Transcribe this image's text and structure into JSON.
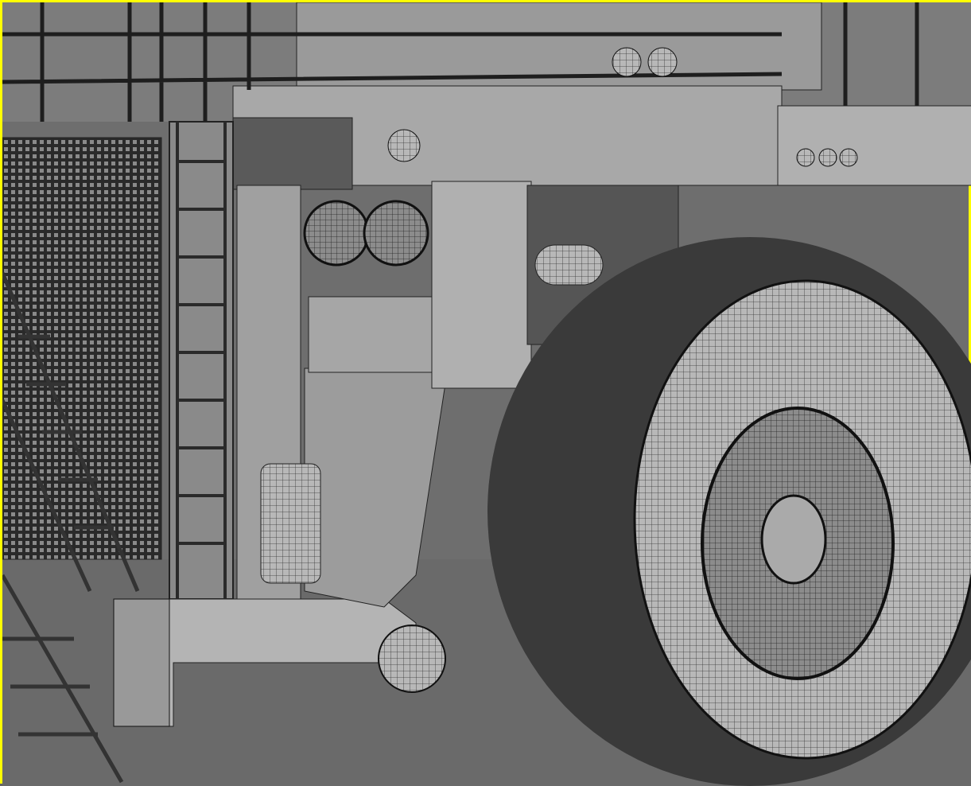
{
  "viewport": {
    "active_border_color": "#ffff00",
    "background_color": "#6e6e6e",
    "render_mode": "wireframe-shaded"
  }
}
